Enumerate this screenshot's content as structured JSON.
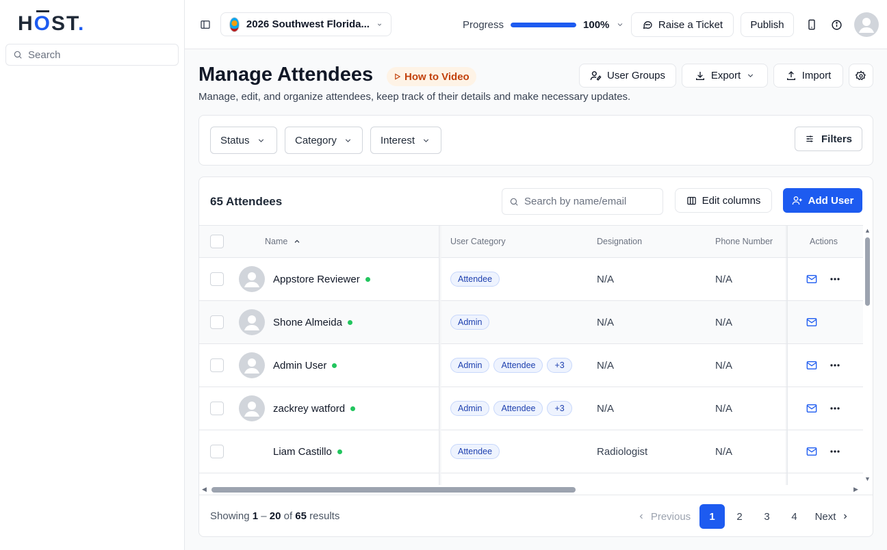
{
  "brand": {
    "logo_h": "H",
    "logo_o": "O",
    "logo_rest": "ST",
    "logo_dot": "."
  },
  "sidebar": {
    "search_placeholder": "Search"
  },
  "topbar": {
    "event_name": "2026 Southwest Florida...",
    "progress_label": "Progress",
    "progress_value": 100,
    "progress_text": "100%",
    "ticket_label": "Raise a Ticket",
    "publish_label": "Publish"
  },
  "page": {
    "title": "Manage Attendees",
    "howto_label": "How to Video",
    "subtitle": "Manage, edit, and organize attendees, keep track of their details and make necessary updates.",
    "user_groups_label": "User Groups",
    "export_label": "Export",
    "import_label": "Import"
  },
  "filters": {
    "status_label": "Status",
    "category_label": "Category",
    "interest_label": "Interest",
    "filters_label": "Filters"
  },
  "table": {
    "count_label": "65 Attendees",
    "search_placeholder": "Search by name/email",
    "edit_columns_label": "Edit columns",
    "add_user_label": "Add User",
    "columns": {
      "name": "Name",
      "category": "User Category",
      "designation": "Designation",
      "phone": "Phone Number",
      "actions": "Actions"
    },
    "rows": [
      {
        "name": "Appstore Reviewer",
        "avatar": true,
        "chips": [
          "Attendee"
        ],
        "designation": "N/A",
        "phone": "N/A",
        "more": true,
        "highlight": false
      },
      {
        "name": "Shone Almeida",
        "avatar": true,
        "chips": [
          "Admin"
        ],
        "designation": "N/A",
        "phone": "N/A",
        "more": false,
        "highlight": true
      },
      {
        "name": "Admin User",
        "avatar": true,
        "chips": [
          "Admin",
          "Attendee",
          "+3"
        ],
        "designation": "N/A",
        "phone": "N/A",
        "more": true,
        "highlight": false
      },
      {
        "name": "zackrey watford",
        "avatar": true,
        "chips": [
          "Admin",
          "Attendee",
          "+3"
        ],
        "designation": "N/A",
        "phone": "N/A",
        "more": true,
        "highlight": false
      },
      {
        "name": "Liam Castillo",
        "avatar": false,
        "chips": [
          "Attendee"
        ],
        "designation": "Radiologist",
        "phone": "N/A",
        "more": true,
        "highlight": false
      }
    ]
  },
  "pagination": {
    "showing_prefix": "Showing ",
    "range_start": "1",
    "range_dash": " – ",
    "range_end": "20",
    "of_text": " of ",
    "total": "65",
    "results_text": " results",
    "previous_label": "Previous",
    "pages": [
      "1",
      "2",
      "3",
      "4"
    ],
    "current_page": "1",
    "next_label": "Next"
  },
  "colors": {
    "accent": "#1d5bf0",
    "online": "#22c55e",
    "howto_bg": "#fef3e6",
    "howto_text": "#c2410c"
  },
  "icons": [
    "search-icon",
    "sidebar-toggle-icon",
    "chevron-down-icon",
    "chat-icon",
    "mobile-icon",
    "info-icon",
    "user-avatar-icon",
    "play-icon",
    "user-groups-icon",
    "download-icon",
    "upload-icon",
    "gear-icon",
    "sliders-icon",
    "columns-icon",
    "user-plus-icon",
    "mail-icon",
    "more-icon",
    "sort-up-icon",
    "chevron-left-icon",
    "chevron-right-icon"
  ]
}
